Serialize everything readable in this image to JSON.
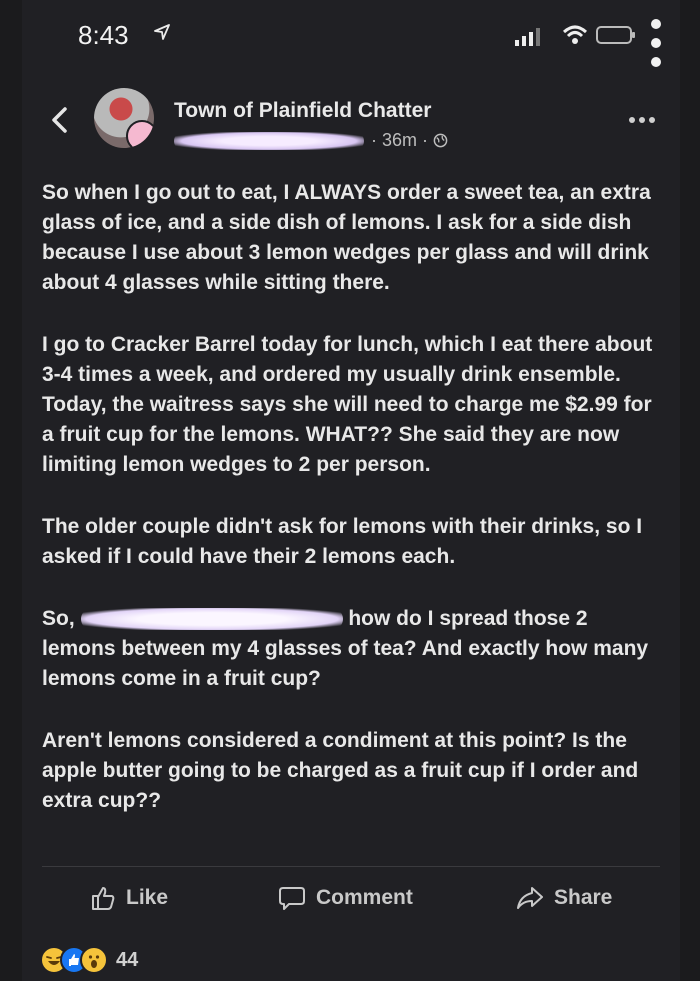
{
  "status_bar": {
    "time": "8:43"
  },
  "post": {
    "page_name": "Town of Plainfield Chatter",
    "timestamp": "36m",
    "separator": " · ",
    "paragraphs": [
      "So when I go out to eat, I ALWAYS order a sweet tea, an extra glass of ice, and a side dish of lemons. I ask for a side dish because I use about 3 lemon wedges per glass and will drink about 4 glasses while sitting there.",
      "I go to Cracker Barrel today for lunch, which I eat there about 3-4 times a week, and ordered my usually drink ensemble. Today, the waitress says she will need to charge me $2.99 for a fruit cup for the lemons. WHAT?? She said they are now limiting lemon wedges to 2 per person.",
      "The older couple didn't ask for lemons with their drinks, so I asked if I could have their 2 lemons each."
    ],
    "para4_start": "So, ",
    "para4_end": " how do I spread those 2 lemons between my 4 glasses of tea? And exactly how many lemons come in a fruit cup?",
    "para5": "Aren't lemons considered a condiment at this point? Is the apple butter going to be charged as a fruit cup if I order and extra cup??"
  },
  "actions": {
    "like_label": "Like",
    "comment_label": "Comment",
    "share_label": "Share"
  },
  "reactions": {
    "count": "44",
    "icons": [
      "haha-react-icon",
      "like-react-icon",
      "wow-react-icon"
    ]
  },
  "colors": {
    "background": "#202024",
    "text": "#e8e8e8",
    "muted": "#bdbdbd"
  }
}
